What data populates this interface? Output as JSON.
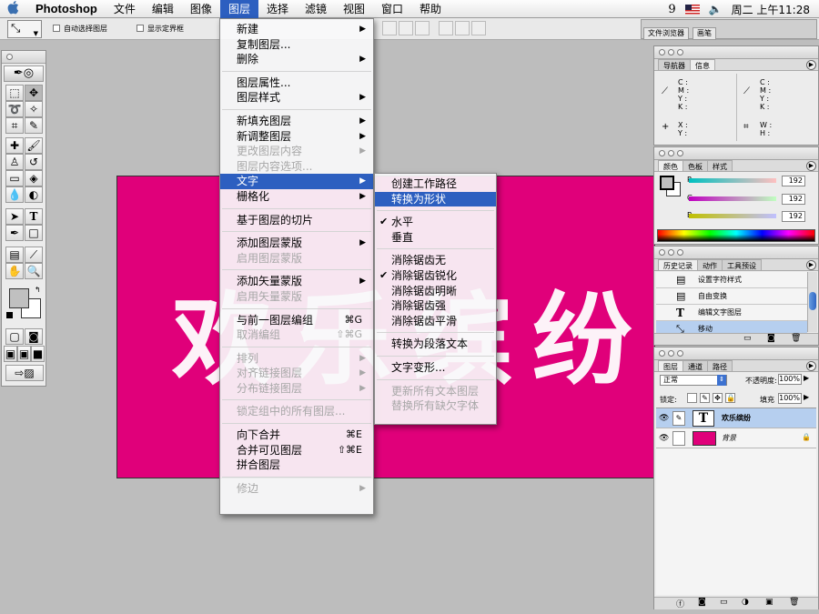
{
  "menubar": {
    "app": "Photoshop",
    "items": [
      "文件",
      "编辑",
      "图像",
      "图层",
      "选择",
      "滤镜",
      "视图",
      "窗口",
      "帮助"
    ],
    "active": "图层",
    "clock": "周二 上午11:28",
    "input_badge": "9"
  },
  "options_bar": {
    "auto_select_label": "自动选择图层",
    "show_bbox_label": "显示定界框",
    "file_browser_tab": "文件浏览器",
    "brushes_tab": "画笔"
  },
  "canvas": {
    "text": "欢乐缤纷",
    "bg_color": "#e0007a"
  },
  "layer_menu": {
    "items": [
      {
        "label": "新建",
        "sub": true
      },
      {
        "label": "复制图层..."
      },
      {
        "label": "删除",
        "sub": true
      },
      {
        "sep": true
      },
      {
        "label": "图层属性..."
      },
      {
        "label": "图层样式",
        "sub": true
      },
      {
        "sep": true
      },
      {
        "label": "新填充图层",
        "sub": true
      },
      {
        "label": "新调整图层",
        "sub": true
      },
      {
        "label": "更改图层内容",
        "sub": true,
        "disabled": true
      },
      {
        "label": "图层内容选项...",
        "disabled": true
      },
      {
        "label": "文字",
        "sub": true,
        "highlight": true
      },
      {
        "label": "栅格化",
        "sub": true
      },
      {
        "sep": true
      },
      {
        "label": "基于图层的切片"
      },
      {
        "sep": true
      },
      {
        "label": "添加图层蒙版",
        "sub": true
      },
      {
        "label": "启用图层蒙版",
        "disabled": true
      },
      {
        "sep": true
      },
      {
        "label": "添加矢量蒙版",
        "sub": true
      },
      {
        "label": "启用矢量蒙版",
        "disabled": true
      },
      {
        "sep": true
      },
      {
        "label": "与前一图层编组",
        "shortcut": "⌘G"
      },
      {
        "label": "取消编组",
        "shortcut": "⇧⌘G",
        "disabled": true
      },
      {
        "sep": true
      },
      {
        "label": "排列",
        "sub": true,
        "disabled": true
      },
      {
        "label": "对齐链接图层",
        "sub": true,
        "disabled": true
      },
      {
        "label": "分布链接图层",
        "sub": true,
        "disabled": true
      },
      {
        "sep": true
      },
      {
        "label": "锁定组中的所有图层...",
        "disabled": true
      },
      {
        "sep": true
      },
      {
        "label": "向下合并",
        "shortcut": "⌘E"
      },
      {
        "label": "合并可见图层",
        "shortcut": "⇧⌘E"
      },
      {
        "label": "拼合图层"
      },
      {
        "sep": true
      },
      {
        "label": "修边",
        "sub": true,
        "disabled": true
      }
    ]
  },
  "type_submenu": {
    "items": [
      {
        "label": "创建工作路径"
      },
      {
        "label": "转换为形状",
        "highlight": true
      },
      {
        "sep": true
      },
      {
        "label": "水平",
        "checked": true
      },
      {
        "label": "垂直"
      },
      {
        "sep": true
      },
      {
        "label": "消除锯齿无"
      },
      {
        "label": "消除锯齿锐化",
        "checked": true
      },
      {
        "label": "消除锯齿明晰"
      },
      {
        "label": "消除锯齿强"
      },
      {
        "label": "消除锯齿平滑"
      },
      {
        "sep": true
      },
      {
        "label": "转换为段落文本"
      },
      {
        "sep": true
      },
      {
        "label": "文字变形..."
      },
      {
        "sep": true
      },
      {
        "label": "更新所有文本图层",
        "disabled": true
      },
      {
        "label": "替换所有缺欠字体",
        "disabled": true
      }
    ]
  },
  "navigator_panel": {
    "tabs": [
      "导航器",
      "信息"
    ],
    "cmyk": [
      "C :",
      "M :",
      "Y :",
      "K :"
    ],
    "cmyk2": [
      "C :",
      "M :",
      "Y :",
      "K :"
    ],
    "xy": [
      "X :",
      "Y :"
    ],
    "wh": [
      "W :",
      "H :"
    ]
  },
  "color_panel": {
    "tabs": [
      "颜色",
      "色板",
      "样式"
    ],
    "channels": [
      {
        "label": "R",
        "value": "192"
      },
      {
        "label": "G",
        "value": "192"
      },
      {
        "label": "B",
        "value": "192"
      }
    ]
  },
  "history_panel": {
    "tabs": [
      "历史记录",
      "动作",
      "工具预设"
    ],
    "items": [
      "设置字符样式",
      "自由变换",
      "编辑文字图层",
      "移动"
    ]
  },
  "layers_panel": {
    "tabs": [
      "图层",
      "通道",
      "路径"
    ],
    "blend_mode": "正常",
    "opacity_label": "不透明度:",
    "opacity_value": "100%",
    "lock_label": "锁定:",
    "fill_label": "填充",
    "fill_value": "100%",
    "layers": [
      {
        "name": "欢乐缤纷",
        "type": "text",
        "selected": true
      },
      {
        "name": "背景",
        "type": "background",
        "color": "#e0007a"
      }
    ]
  }
}
